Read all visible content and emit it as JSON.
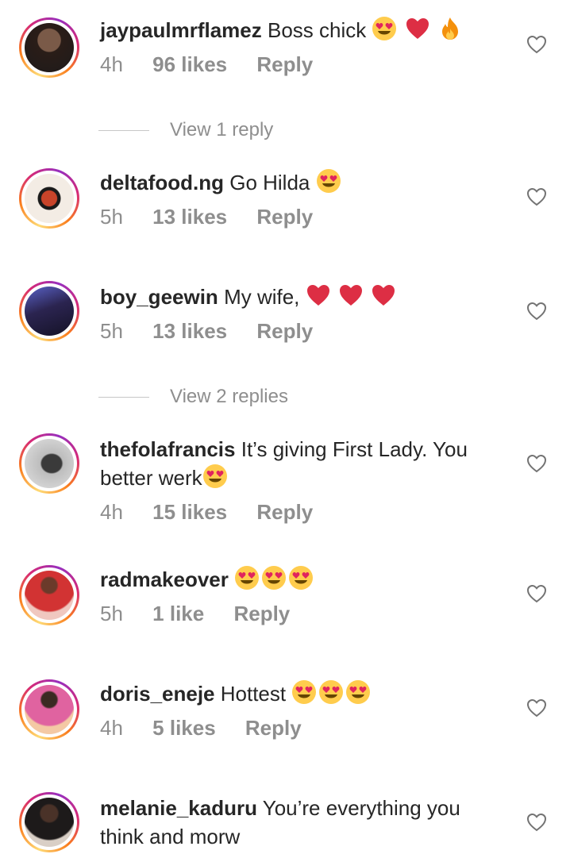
{
  "comments": [
    {
      "username": "jaypaulmrflamez",
      "text": "Boss chick",
      "emojis": [
        "heart-eyes",
        "red-heart",
        "fire"
      ],
      "time": "4h",
      "likes": "96 likes",
      "reply": "Reply",
      "avatar_color": "#3a2a22"
    },
    {
      "username": "deltafood.ng",
      "text": "Go Hilda",
      "emojis": [
        "heart-eyes"
      ],
      "time": "5h",
      "likes": "13 likes",
      "reply": "Reply",
      "avatar_color": "#c8442a"
    },
    {
      "username": "boy_geewin",
      "text": "My wife,",
      "emojis": [
        "red-heart",
        "red-heart",
        "red-heart"
      ],
      "time": "5h",
      "likes": "13 likes",
      "reply": "Reply",
      "avatar_color": "#3d3566"
    },
    {
      "username": "thefolafrancis",
      "text": "It’s giving First Lady. You better werk",
      "emojis": [
        "heart-eyes"
      ],
      "time": "4h",
      "likes": "15 likes",
      "reply": "Reply",
      "avatar_color": "#9a9a9a"
    },
    {
      "username": "radmakeover",
      "text": "",
      "emojis": [
        "heart-eyes",
        "heart-eyes",
        "heart-eyes"
      ],
      "time": "5h",
      "likes": "1 like",
      "reply": "Reply",
      "avatar_color": "#b8202a"
    },
    {
      "username": "doris_eneje",
      "text": "Hottest",
      "emojis": [
        "heart-eyes",
        "heart-eyes",
        "heart-eyes"
      ],
      "time": "4h",
      "likes": "5 likes",
      "reply": "Reply",
      "avatar_color": "#d4407a"
    },
    {
      "username": "melanie_kaduru",
      "text": "You’re everything you think and morw",
      "emojis": [],
      "time": "",
      "likes": "",
      "reply": "",
      "avatar_color": "#4a3b34"
    }
  ],
  "view_replies": [
    {
      "label": "View 1 reply"
    },
    {
      "label": "View 2 replies"
    }
  ],
  "colors": {
    "meta": "#8e8e8e",
    "text": "#262626",
    "ring_start": "#fa7e1e",
    "ring_end": "#d62976"
  }
}
